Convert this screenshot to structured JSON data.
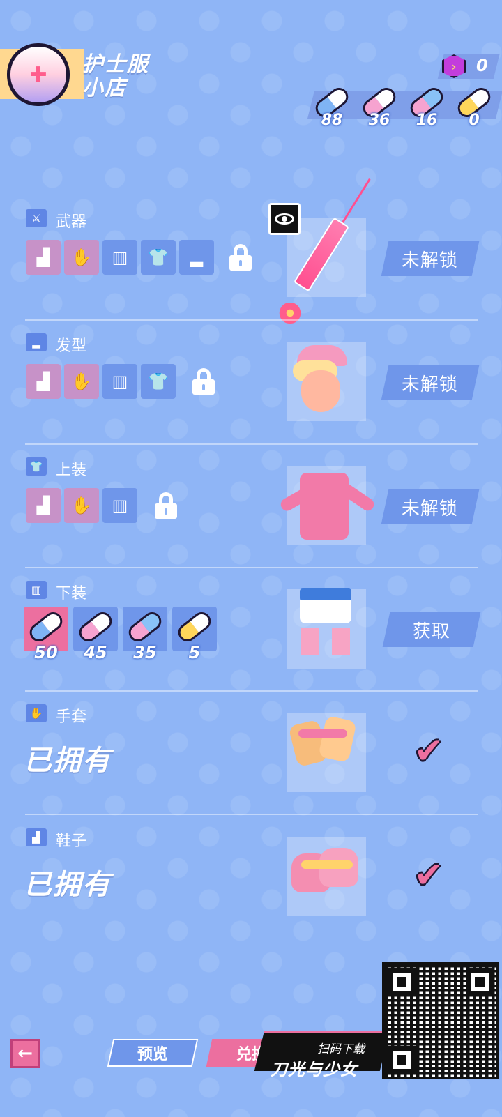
{
  "header": {
    "shop_title_line1": "护士服",
    "shop_title_line2": "小店",
    "shop_avatar_icon": "nurse-cross-icon",
    "gem_count": "0"
  },
  "resources": [
    {
      "color": "#7fb4f5",
      "count": "88"
    },
    {
      "color": "#f6a3d0",
      "count": "36"
    },
    {
      "color": "#89c2f7",
      "count": "16"
    },
    {
      "color": "#ffd65a",
      "count": "0"
    }
  ],
  "rows": {
    "weapon": {
      "label": "武器",
      "icon": "sword-icon",
      "action": "未解锁"
    },
    "hair": {
      "label": "发型",
      "icon": "hat-icon",
      "action": "未解锁"
    },
    "top": {
      "label": "上装",
      "icon": "shirt-icon",
      "action": "未解锁"
    },
    "bottom": {
      "label": "下装",
      "icon": "shorts-icon",
      "action": "获取",
      "costs": [
        {
          "color": "#7fb4f5",
          "count": "50"
        },
        {
          "color": "#f6a3d0",
          "count": "45"
        },
        {
          "color": "#89c2f7",
          "count": "35"
        },
        {
          "color": "#ffd65a",
          "count": "5"
        }
      ]
    },
    "gloves": {
      "label": "手套",
      "icon": "glove-icon",
      "status": "已拥有"
    },
    "shoes": {
      "label": "鞋子",
      "icon": "shoe-icon",
      "status": "已拥有"
    }
  },
  "footer": {
    "back_icon": "arrow-left-icon",
    "preview_label": "预览",
    "exchange_label": "兑换",
    "promo_sub": "扫码下载",
    "promo_name": "刀光与少女"
  },
  "colors": {
    "background": "#8fb5f6",
    "slot_pink": "#c792c8",
    "slot_blue": "#6f96ea",
    "accent_pink": "#ec6f9f"
  }
}
